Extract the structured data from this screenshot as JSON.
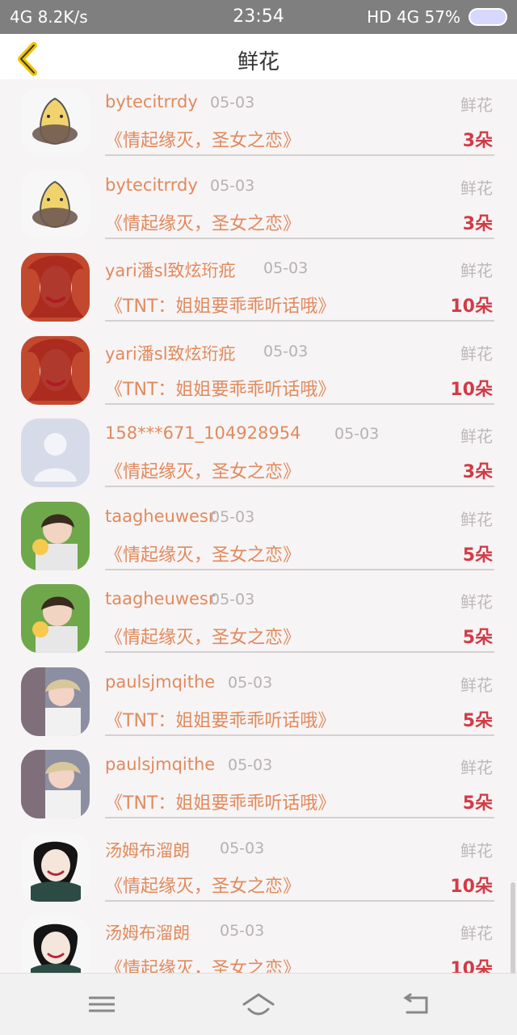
{
  "status": {
    "left": "4G 8.2K/s",
    "time": "23:54",
    "right": "HD 4G 57%"
  },
  "header": {
    "title": "鲜花"
  },
  "items": [
    {
      "name": "bytecitrrdy",
      "date": "05-03",
      "gift": "鲜花",
      "book": "《情起缘灭，圣女之恋》",
      "count": "3朵",
      "avatar_kind": "cartoon"
    },
    {
      "name": "bytecitrrdy",
      "date": "05-03",
      "gift": "鲜花",
      "book": "《情起缘灭，圣女之恋》",
      "count": "3朵",
      "avatar_kind": "cartoon"
    },
    {
      "name": "yari潘sl致炫珩疪",
      "date": "05-03",
      "gift": "鲜花",
      "book": "《TNT：姐姐要乖乖听话哦》",
      "count": "10朵",
      "avatar_kind": "redhair"
    },
    {
      "name": "yari潘sl致炫珩疪",
      "date": "05-03",
      "gift": "鲜花",
      "book": "《TNT：姐姐要乖乖听话哦》",
      "count": "10朵",
      "avatar_kind": "redhair"
    },
    {
      "name": "158***671_104928954",
      "date": "05-03",
      "gift": "鲜花",
      "book": "《情起缘灭，圣女之恋》",
      "count": "3朵",
      "avatar_kind": "default"
    },
    {
      "name": "taagheuwesr",
      "date": "05-03",
      "gift": "鲜花",
      "book": "《情起缘灭，圣女之恋》",
      "count": "5朵",
      "avatar_kind": "boy"
    },
    {
      "name": "taagheuwesr",
      "date": "05-03",
      "gift": "鲜花",
      "book": "《情起缘灭，圣女之恋》",
      "count": "5朵",
      "avatar_kind": "boy"
    },
    {
      "name": "paulsjmqithe",
      "date": "05-03",
      "gift": "鲜花",
      "book": "《TNT：姐姐要乖乖听话哦》",
      "count": "5朵",
      "avatar_kind": "blonde"
    },
    {
      "name": "paulsjmqithe",
      "date": "05-03",
      "gift": "鲜花",
      "book": "《TNT：姐姐要乖乖听话哦》",
      "count": "5朵",
      "avatar_kind": "blonde"
    },
    {
      "name": "汤姆布溜朗",
      "date": "05-03",
      "gift": "鲜花",
      "book": "《情起缘灭，圣女之恋》",
      "count": "10朵",
      "avatar_kind": "illustration"
    },
    {
      "name": "汤姆布溜朗",
      "date": "05-03",
      "gift": "鲜花",
      "book": "《情起缘灭，圣女之恋》",
      "count": "10朵",
      "avatar_kind": "illustration"
    }
  ],
  "nav": {
    "menu_icon": "menu-icon",
    "home_icon": "home-icon",
    "back_icon": "back-icon"
  }
}
